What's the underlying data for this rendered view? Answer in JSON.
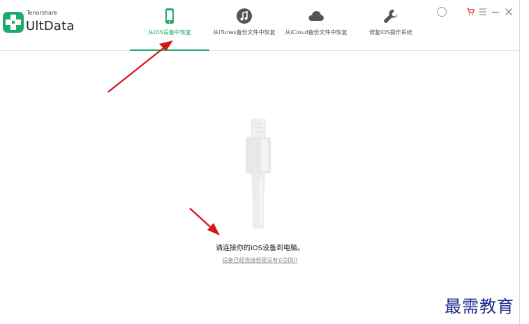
{
  "app": {
    "brand_small": "Tenorshare",
    "brand_name": "UltData"
  },
  "tabs": [
    {
      "label": "从iOS设备中恢复",
      "icon": "phone-icon",
      "active": true
    },
    {
      "label": "从iTunes备份文件中恢复",
      "icon": "music-icon",
      "active": false
    },
    {
      "label": "从iCloud备份文件中恢复",
      "icon": "cloud-icon",
      "active": false
    },
    {
      "label": "修复iOS操作系统",
      "icon": "wrench-icon",
      "active": false
    }
  ],
  "window_controls": [
    "circle-icon",
    "cart-icon",
    "menu-icon",
    "minimize-icon",
    "close-icon"
  ],
  "main": {
    "prompt": "请连接你的iOS设备到电脑。",
    "help_link": "设备已经连接但是没有识别到?"
  },
  "watermark": "最需教育",
  "colors": {
    "accent": "#1dab6b",
    "icon_gray": "#555555",
    "arrow_red": "#d8141a",
    "watermark": "#1a2b8c"
  }
}
